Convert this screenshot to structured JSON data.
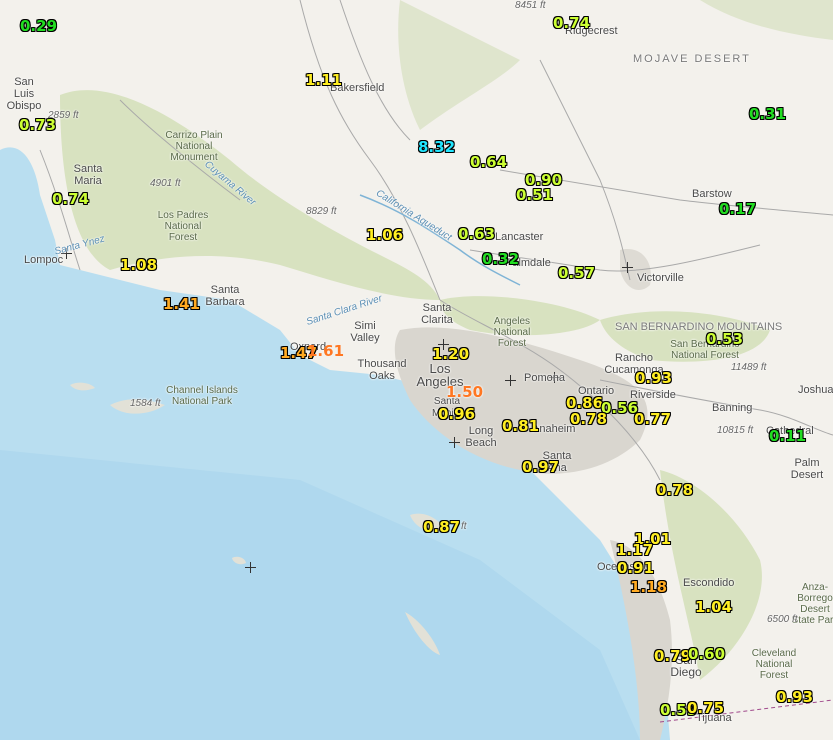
{
  "colors": {
    "ocean": "#b9def0",
    "land": "#f3f1ec",
    "forest": "#d8e2c0",
    "terrain_shade": "#e6e4dc",
    "urban": "#d9d6cf",
    "value_green": "#22dd22",
    "value_yellowgreen": "#ccff33",
    "value_yellow": "#ffee22",
    "value_orange": "#ffaa22",
    "value_cyan": "#22e6ff",
    "value_darkorange": "#ff7722"
  },
  "places": [
    {
      "id": "bakersfield",
      "text": "Bakersfield"
    },
    {
      "id": "ridgecrest",
      "text": "Ridgecrest"
    },
    {
      "id": "mojave",
      "text": "MOJAVE DESERT"
    },
    {
      "id": "san-luis-obispo",
      "text": "San Luis Obispo"
    },
    {
      "id": "carrizo",
      "text": "Carrizo Plain National Monument"
    },
    {
      "id": "santa-maria",
      "text": "Santa Maria"
    },
    {
      "id": "cuyama",
      "text": "Cuyama River"
    },
    {
      "id": "los-padres",
      "text": "Los Padres National Forest"
    },
    {
      "id": "lompoc",
      "text": "Lompoc"
    },
    {
      "id": "santa-ynez",
      "text": "Santa Ynez"
    },
    {
      "id": "santa-barbara",
      "text": "Santa Barbara"
    },
    {
      "id": "ca-aqueduct",
      "text": "California Aqueduct"
    },
    {
      "id": "lancaster",
      "text": "Lancaster"
    },
    {
      "id": "palmdale",
      "text": "Palmdale"
    },
    {
      "id": "victorville",
      "text": "Victorville"
    },
    {
      "id": "barstow",
      "text": "Barstow"
    },
    {
      "id": "santa-clara-river",
      "text": "Santa Clara River"
    },
    {
      "id": "santa-clarita",
      "text": "Santa Clarita"
    },
    {
      "id": "angeles-nf",
      "text": "Angeles National Forest"
    },
    {
      "id": "sb-mountains",
      "text": "SAN BERNARDINO MOUNTAINS"
    },
    {
      "id": "sb-nf",
      "text": "San Bernardino National Forest"
    },
    {
      "id": "simi",
      "text": "Simi Valley"
    },
    {
      "id": "thousand-oaks",
      "text": "Thousand Oaks"
    },
    {
      "id": "oxnard",
      "text": "Oxnard"
    },
    {
      "id": "los-angeles",
      "text": "Los Angeles"
    },
    {
      "id": "pomona",
      "text": "Pomona"
    },
    {
      "id": "rancho",
      "text": "Rancho Cucamonga"
    },
    {
      "id": "ontario",
      "text": "Ontario"
    },
    {
      "id": "riverside",
      "text": "Riverside"
    },
    {
      "id": "banning",
      "text": "Banning"
    },
    {
      "id": "joshua",
      "text": "Joshua"
    },
    {
      "id": "cathedral",
      "text": "Cathedral"
    },
    {
      "id": "palm-desert",
      "text": "Palm Desert"
    },
    {
      "id": "channel-islands",
      "text": "Channel Islands National Park"
    },
    {
      "id": "santa-monica",
      "text": "Santa Monica"
    },
    {
      "id": "long-beach",
      "text": "Long Beach"
    },
    {
      "id": "anaheim",
      "text": "Anaheim"
    },
    {
      "id": "santa-ana",
      "text": "Santa Ana"
    },
    {
      "id": "oceanside",
      "text": "Oceanside"
    },
    {
      "id": "escondido",
      "text": "Escondido"
    },
    {
      "id": "anza-borrego",
      "text": "Anza-Borrego Desert State Park"
    },
    {
      "id": "cleveland",
      "text": "Cleveland National Forest"
    },
    {
      "id": "san-diego",
      "text": "San Diego"
    },
    {
      "id": "tijuana",
      "text": "Tijuana"
    }
  ],
  "elevations": [
    "8451 ft",
    "2859 ft",
    "4901 ft",
    "8829 ft",
    "1584 ft",
    "11489 ft",
    "10815 ft",
    "6500 ft",
    "ft"
  ],
  "values": [
    {
      "v": "0.29",
      "c": "green"
    },
    {
      "v": "0.74",
      "c": "yellowgreen"
    },
    {
      "v": "1.11",
      "c": "yellow"
    },
    {
      "v": "0.73",
      "c": "yellowgreen"
    },
    {
      "v": "0.31",
      "c": "green"
    },
    {
      "v": "8.32",
      "c": "cyan"
    },
    {
      "v": "0.64",
      "c": "yellowgreen"
    },
    {
      "v": "0.90",
      "c": "yellowgreen"
    },
    {
      "v": "0.51",
      "c": "yellowgreen"
    },
    {
      "v": "0.74",
      "c": "yellowgreen"
    },
    {
      "v": "0.17",
      "c": "green"
    },
    {
      "v": "1.06",
      "c": "yellow"
    },
    {
      "v": "0.63",
      "c": "yellowgreen"
    },
    {
      "v": "0.32",
      "c": "green"
    },
    {
      "v": "1.08",
      "c": "yellow"
    },
    {
      "v": "0.57",
      "c": "yellowgreen"
    },
    {
      "v": "1.41",
      "c": "orange"
    },
    {
      "v": "0.53",
      "c": "yellowgreen"
    },
    {
      "v": "1.47",
      "c": "orange"
    },
    {
      "v": "1.61",
      "c": "darkorange"
    },
    {
      "v": "1.20",
      "c": "yellow"
    },
    {
      "v": "0.93",
      "c": "yellow"
    },
    {
      "v": "1.50",
      "c": "darkorange"
    },
    {
      "v": "0.86",
      "c": "yellow"
    },
    {
      "v": "0.56",
      "c": "yellowgreen"
    },
    {
      "v": "0.96",
      "c": "yellow"
    },
    {
      "v": "0.78",
      "c": "yellow"
    },
    {
      "v": "0.77",
      "c": "yellow"
    },
    {
      "v": "0.81",
      "c": "yellow"
    },
    {
      "v": "0.11",
      "c": "green"
    },
    {
      "v": "0.97",
      "c": "yellow"
    },
    {
      "v": "0.78",
      "c": "yellow"
    },
    {
      "v": "0.87",
      "c": "yellow"
    },
    {
      "v": "1.01",
      "c": "yellow"
    },
    {
      "v": "1.17",
      "c": "yellow"
    },
    {
      "v": "0.91",
      "c": "yellow"
    },
    {
      "v": "1.18",
      "c": "orange"
    },
    {
      "v": "1.04",
      "c": "yellow"
    },
    {
      "v": "0.79",
      "c": "yellow"
    },
    {
      "v": "0.60",
      "c": "yellowgreen"
    },
    {
      "v": "0.59",
      "c": "yellowgreen"
    },
    {
      "v": "0.75",
      "c": "yellow"
    },
    {
      "v": "0.93",
      "c": "yellow"
    }
  ]
}
